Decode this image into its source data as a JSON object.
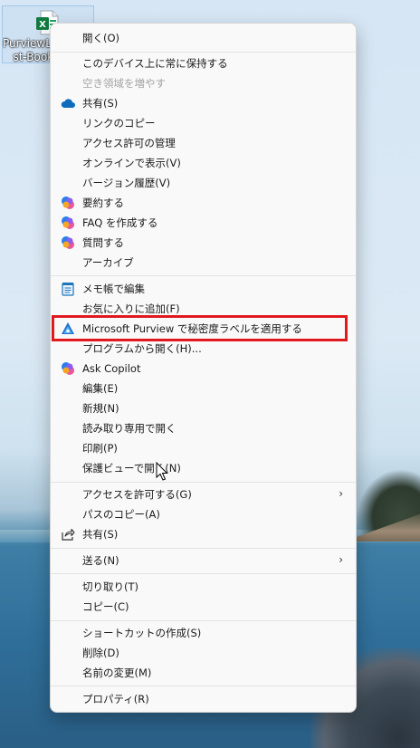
{
  "desktop": {
    "file_icon": "excel-file-icon",
    "file_label": "PurviewLa\n   st-Book"
  },
  "menu": {
    "items": [
      {
        "label": "開く(O)",
        "icon": "",
        "disabled": false
      },
      {
        "label": "このデバイス上に常に保持する",
        "icon": "",
        "disabled": false
      },
      {
        "label": "空き領域を増やす",
        "icon": "",
        "disabled": true
      },
      {
        "label": "共有(S)",
        "icon": "onedrive-cloud-icon",
        "disabled": false
      },
      {
        "label": "リンクのコピー",
        "icon": "",
        "disabled": false
      },
      {
        "label": "アクセス許可の管理",
        "icon": "",
        "disabled": false
      },
      {
        "label": "オンラインで表示(V)",
        "icon": "",
        "disabled": false
      },
      {
        "label": "バージョン履歴(V)",
        "icon": "",
        "disabled": false
      },
      {
        "label": "要約する",
        "icon": "copilot-icon",
        "disabled": false
      },
      {
        "label": "FAQ を作成する",
        "icon": "copilot-icon",
        "disabled": false
      },
      {
        "label": "質問する",
        "icon": "copilot-icon",
        "disabled": false
      },
      {
        "label": "アーカイブ",
        "icon": "",
        "disabled": false
      },
      {
        "label": "メモ帳で編集",
        "icon": "notepad-icon",
        "disabled": false
      },
      {
        "label": "お気に入りに追加(F)",
        "icon": "",
        "disabled": false
      },
      {
        "label": "Microsoft Purview で秘密度ラベルを適用する",
        "icon": "purview-icon",
        "disabled": false
      },
      {
        "label": "プログラムから開く(H)...",
        "icon": "",
        "disabled": false
      },
      {
        "label": "Ask Copilot",
        "icon": "copilot-icon",
        "disabled": false
      },
      {
        "label": "編集(E)",
        "icon": "",
        "disabled": false
      },
      {
        "label": "新規(N)",
        "icon": "",
        "disabled": false
      },
      {
        "label": "読み取り専用で開く",
        "icon": "",
        "disabled": false
      },
      {
        "label": "印刷(P)",
        "icon": "",
        "disabled": false
      },
      {
        "label": "保護ビューで開く(N)",
        "icon": "",
        "disabled": false
      },
      {
        "label": "アクセスを許可する(G)",
        "icon": "",
        "disabled": false
      },
      {
        "label": "パスのコピー(A)",
        "icon": "",
        "disabled": false
      },
      {
        "label": "共有(S)",
        "icon": "share-icon",
        "disabled": false
      },
      {
        "label": "送る(N)",
        "icon": "",
        "disabled": false
      },
      {
        "label": "切り取り(T)",
        "icon": "",
        "disabled": false
      },
      {
        "label": "コピー(C)",
        "icon": "",
        "disabled": false
      },
      {
        "label": "ショートカットの作成(S)",
        "icon": "",
        "disabled": false
      },
      {
        "label": "削除(D)",
        "icon": "",
        "disabled": false
      },
      {
        "label": "名前の変更(M)",
        "icon": "",
        "disabled": false
      },
      {
        "label": "プロパティ(R)",
        "icon": "",
        "disabled": false
      }
    ],
    "submenu_arrow": "›",
    "highlight_color": "#e0191f"
  }
}
